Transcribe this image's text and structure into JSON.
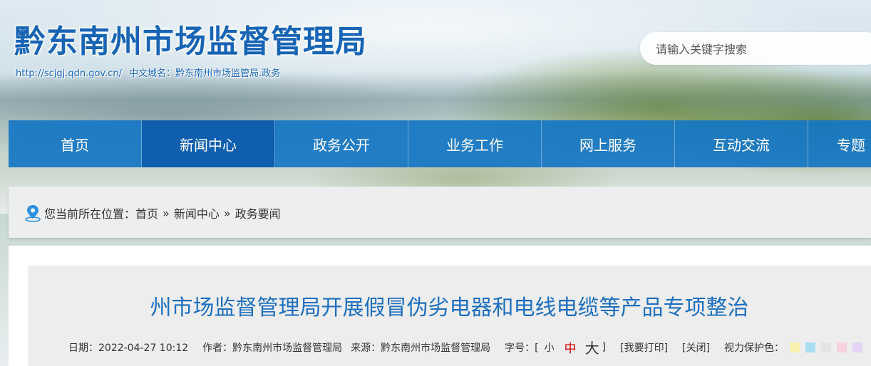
{
  "header": {
    "title": "黔东南州市场监督管理局",
    "url": "http://scjgj.qdn.gov.cn/",
    "domain_label": "中文域名：黔东南州市场监管局.政务"
  },
  "search": {
    "placeholder": "请输入关键字搜索"
  },
  "nav": {
    "items": [
      {
        "label": "首页"
      },
      {
        "label": "新闻中心",
        "active": true
      },
      {
        "label": "政务公开"
      },
      {
        "label": "业务工作"
      },
      {
        "label": "网上服务"
      },
      {
        "label": "互动交流"
      },
      {
        "label": "专题"
      }
    ]
  },
  "breadcrumb": {
    "prefix": "您当前所在位置：",
    "items": [
      "首页",
      "新闻中心",
      "政务要闻"
    ],
    "separator": "»",
    "icon": "location-pin-icon"
  },
  "article": {
    "title": "州市场监督管理局开展假冒伪劣电器和电线电缆等产品专项整治",
    "date": "日期：2022-04-27 10:12",
    "author": "作者：黔东南州市场监督管理局",
    "source": "来源：黔东南州市场监督管理局",
    "font_size_label": "字号：[",
    "font_small": "小",
    "font_medium": "中",
    "font_large": "大",
    "font_close_bracket": "]",
    "print": "[我要打印]",
    "close": "[关闭]",
    "eye_care_label": "视力保护色：",
    "eye_care_colors": [
      "#f7f2b0",
      "#a9dcf0",
      "#e3e3e3",
      "#f6d3dc",
      "#e2d4f2"
    ]
  },
  "colors": {
    "brand_blue": "#1764b5",
    "nav_bg": "#1676c4",
    "nav_active": "#0f5fae",
    "title_blue": "#1d6fbf"
  }
}
